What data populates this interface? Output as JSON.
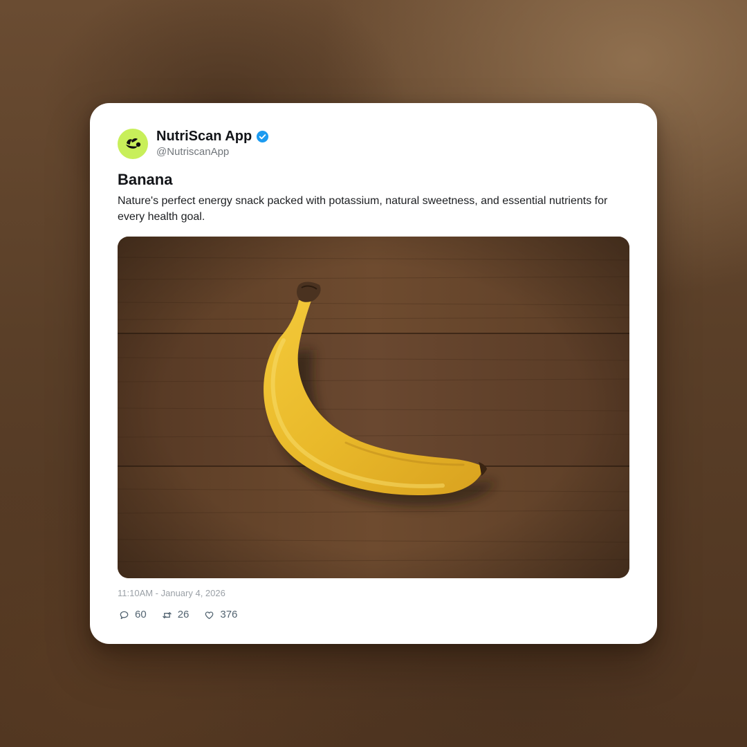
{
  "post": {
    "account": {
      "display_name": "NutriScan App",
      "handle": "@NutriscanApp",
      "verified": true,
      "avatar_icon": "leaf-scan-logo-icon",
      "avatar_color": "#c8ef5a",
      "verified_color": "#1d9bf0"
    },
    "title": "Banana",
    "description": "Nature's perfect energy snack packed with potassium, natural sweetness, and essential nutrients for every health goal.",
    "image": {
      "subject": "banana-on-wood-table-photo"
    },
    "timestamp": "11:10AM - January 4, 2026",
    "stats": {
      "replies": "60",
      "reposts": "26",
      "likes": "376"
    }
  }
}
